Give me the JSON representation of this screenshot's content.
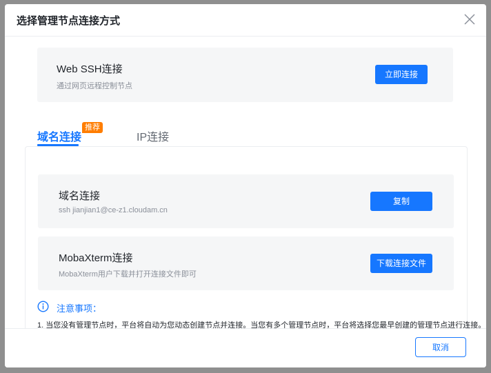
{
  "dialog": {
    "title": "选择管理节点连接方式",
    "close_icon": "close-icon"
  },
  "web_ssh": {
    "title": "Web SSH连接",
    "subtitle": "通过网页远程控制节点",
    "button_label": "立即连接"
  },
  "tabs": [
    {
      "label": "域名连接",
      "active": true,
      "badge": "推荐"
    },
    {
      "label": "IP连接",
      "active": false
    }
  ],
  "domain_card": {
    "title": "域名连接",
    "subtitle": "ssh jianjian1@ce-z1.cloudam.cn",
    "button_label": "复制"
  },
  "moba_card": {
    "title": "MobaXterm连接",
    "subtitle": "MobaXterm用户下载并打开连接文件即可",
    "button_label": "下载连接文件"
  },
  "notice": {
    "icon": "info-icon",
    "title": "注意事项：",
    "line1": "1. 当您没有管理节点时，平台将自动为您动态创建节点并连接。当您有多个管理节点时，平台将选择您最早创建的管理节点进行连接。"
  },
  "footer": {
    "cancel_label": "取消"
  },
  "colors": {
    "primary": "#1677ff",
    "badge": "#ff7d00",
    "card_bg": "#f5f6f7"
  }
}
